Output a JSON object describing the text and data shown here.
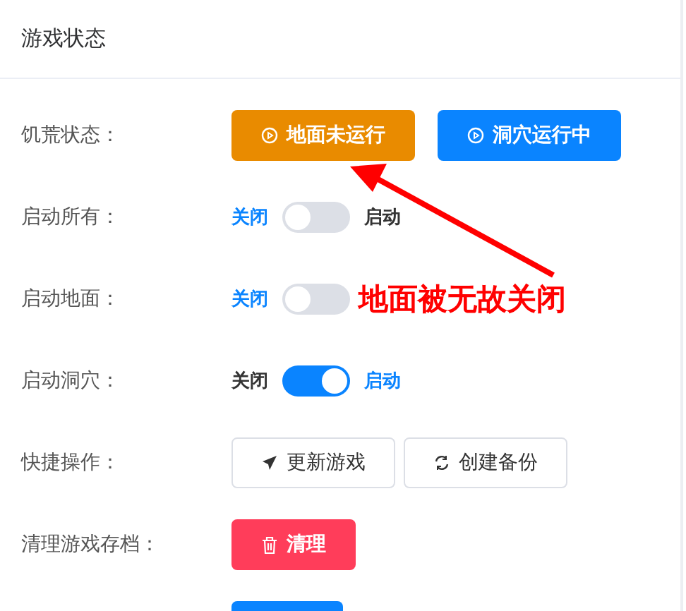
{
  "card": {
    "title": "游戏状态"
  },
  "rows": [
    {
      "kind": "status",
      "label": "饥荒状态：",
      "buttons": [
        {
          "text": "地面未运行",
          "color": "#e98b00"
        },
        {
          "text": "洞穴运行中",
          "color": "#0a84ff"
        }
      ]
    },
    {
      "kind": "switch",
      "label": "启动所有：",
      "off_text": "关闭",
      "on_text": "启动",
      "on": false
    },
    {
      "kind": "switch",
      "label": "启动地面：",
      "off_text": "关闭",
      "on": false
    },
    {
      "kind": "switch",
      "label": "启动洞穴：",
      "off_text": "关闭",
      "on_text": "启动",
      "on": true
    },
    {
      "kind": "actions",
      "label": "快捷操作：",
      "buttons": [
        {
          "text": "更新游戏",
          "kind": "send"
        },
        {
          "text": "创建备份",
          "kind": "refresh"
        }
      ]
    },
    {
      "kind": "danger",
      "label": "清理游戏存档：",
      "buttons": [
        {
          "text": "清理",
          "kind": "delete"
        }
      ]
    },
    {
      "kind": "cut-button"
    }
  ],
  "annotation": {
    "text": "地面被无故关闭"
  }
}
